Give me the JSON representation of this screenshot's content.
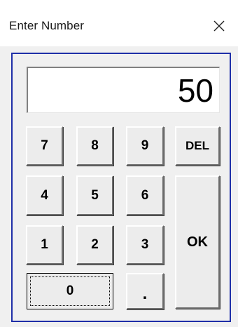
{
  "window": {
    "title": "Enter Number",
    "close_glyph": "✕"
  },
  "display": {
    "value": "50"
  },
  "keys": {
    "seven": "7",
    "eight": "8",
    "nine": "9",
    "del": "DEL",
    "four": "4",
    "five": "5",
    "six": "6",
    "one": "1",
    "two": "2",
    "three": "3",
    "ok": "OK",
    "zero": "0",
    "dot": "."
  },
  "icons": {
    "close": "close-icon"
  },
  "colors": {
    "frame_border": "#1f2fa8",
    "background": "#f0f0f0",
    "display_bg": "#ffffff"
  }
}
